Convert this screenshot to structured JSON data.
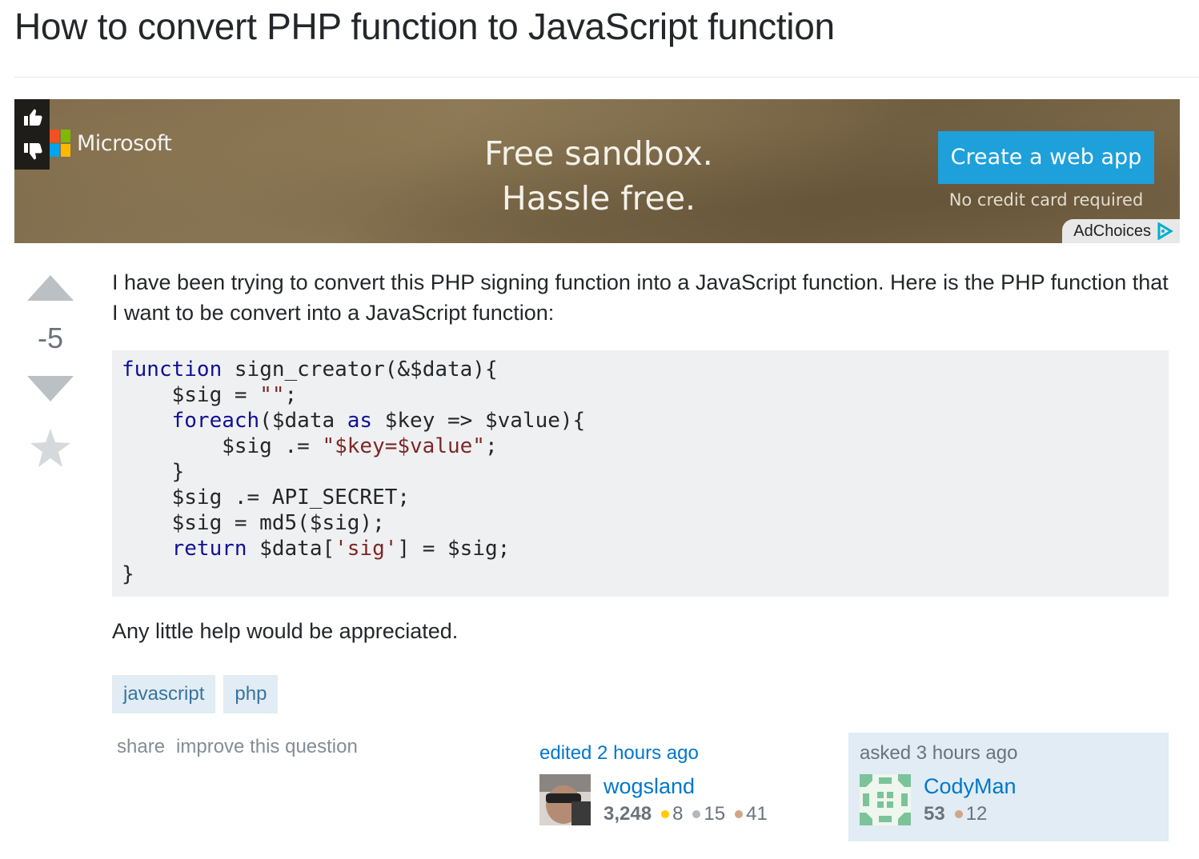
{
  "question": {
    "title": "How to convert PHP function to JavaScript function",
    "score": "-5",
    "body_intro": "I have been trying to convert this PHP signing function into a JavaScript function. Here is the PHP function that I want to be convert into a JavaScript function:",
    "body_outro": "Any little help would be appreciated.",
    "tags": [
      "javascript",
      "php"
    ]
  },
  "ad": {
    "brand": "Microsoft",
    "headline_line1": "Free sandbox.",
    "headline_line2": "Hassle free.",
    "cta": "Create a web app",
    "subtext": "No credit card required",
    "adchoices": "AdChoices"
  },
  "post_menu": {
    "share": "share",
    "improve": "improve this question"
  },
  "edited": {
    "time": "edited 2 hours ago",
    "user": "wogsland",
    "reputation": "3,248",
    "gold": "8",
    "silver": "15",
    "bronze": "41"
  },
  "asked": {
    "time": "asked 3 hours ago",
    "user": "CodyMan",
    "reputation": "53",
    "bronze": "12"
  },
  "colors": {
    "link": "#0077cc",
    "tag_bg": "#e1ecf4",
    "tag_text": "#39739d",
    "code_bg": "#eff0f1",
    "gold": "#ffcc01",
    "silver": "#b4b8bc",
    "bronze": "#d1a684"
  },
  "icons": [
    "vote-up-arrow",
    "vote-down-arrow",
    "favorite-star",
    "thumbs-up",
    "thumbs-down",
    "adchoices-triangle"
  ]
}
